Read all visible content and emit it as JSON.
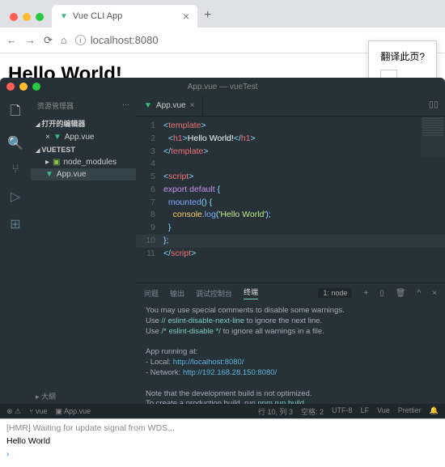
{
  "browser": {
    "tab_title": "Vue CLI App",
    "url": "localhost:8080",
    "page_heading": "Hello World!",
    "translate_prompt": "翻译此页?"
  },
  "editor": {
    "window_title": "App.vue — vueTest",
    "explorer_title": "资源管理器",
    "open_editors": "打开的编辑器",
    "project": "VUETEST",
    "node_modules": "node_modules",
    "app_vue": "App.vue",
    "outline": "大纲",
    "tab": "App.vue",
    "code": {
      "l1a": "<",
      "l1b": "template",
      "l1c": ">",
      "l2a": "  <",
      "l2b": "h1",
      "l2c": ">",
      "l2d": "Hello World!",
      "l2e": "</",
      "l2f": "h1",
      "l2g": ">",
      "l3a": "</",
      "l3b": "template",
      "l3c": ">",
      "l5a": "<",
      "l5b": "script",
      "l5c": ">",
      "l6a": "export default",
      "l6b": " {",
      "l7a": "  ",
      "l7b": "mounted",
      "l7c": "() {",
      "l8a": "    ",
      "l8b": "console",
      "l8c": ".",
      "l8d": "log",
      "l8e": "(",
      "l8f": "'Hello World'",
      "l8g": ");",
      "l9": "  }",
      "l10": "};",
      "l11a": "</",
      "l11b": "script",
      "l11c": ">"
    },
    "terminal": {
      "tabs": {
        "problems": "问题",
        "output": "输出",
        "debug": "调试控制台",
        "terminal": "终端"
      },
      "selector": "1: node",
      "l1": "You may use special comments to disable some warnings.",
      "l2a": "Use ",
      "l2b": "// eslint-disable-next-line",
      "l2c": " to ignore the next line.",
      "l3a": "Use ",
      "l3b": "/* eslint-disable */",
      "l3c": " to ignore all warnings in a file.",
      "l5": "App running at:",
      "l6a": "- Local:   ",
      "l6b": "http://localhost:8080/",
      "l7a": "- Network: ",
      "l7b": "http://192.168.28.150:8080/",
      "l9": "Note that the development build is not optimized.",
      "l10a": "To create a production build, run ",
      "l10b": "npm run build",
      "l10c": "."
    },
    "status": {
      "branch": "vue",
      "file": "App.vue",
      "pos": "行 10, 列 3",
      "spaces": "空格: 2",
      "enc": "UTF-8",
      "eol": "LF",
      "lang": "Vue",
      "prettier": "Prettier"
    }
  },
  "devtools": {
    "hmr": "[HMR] Waiting for update signal from WDS...",
    "log": "Hello World"
  }
}
